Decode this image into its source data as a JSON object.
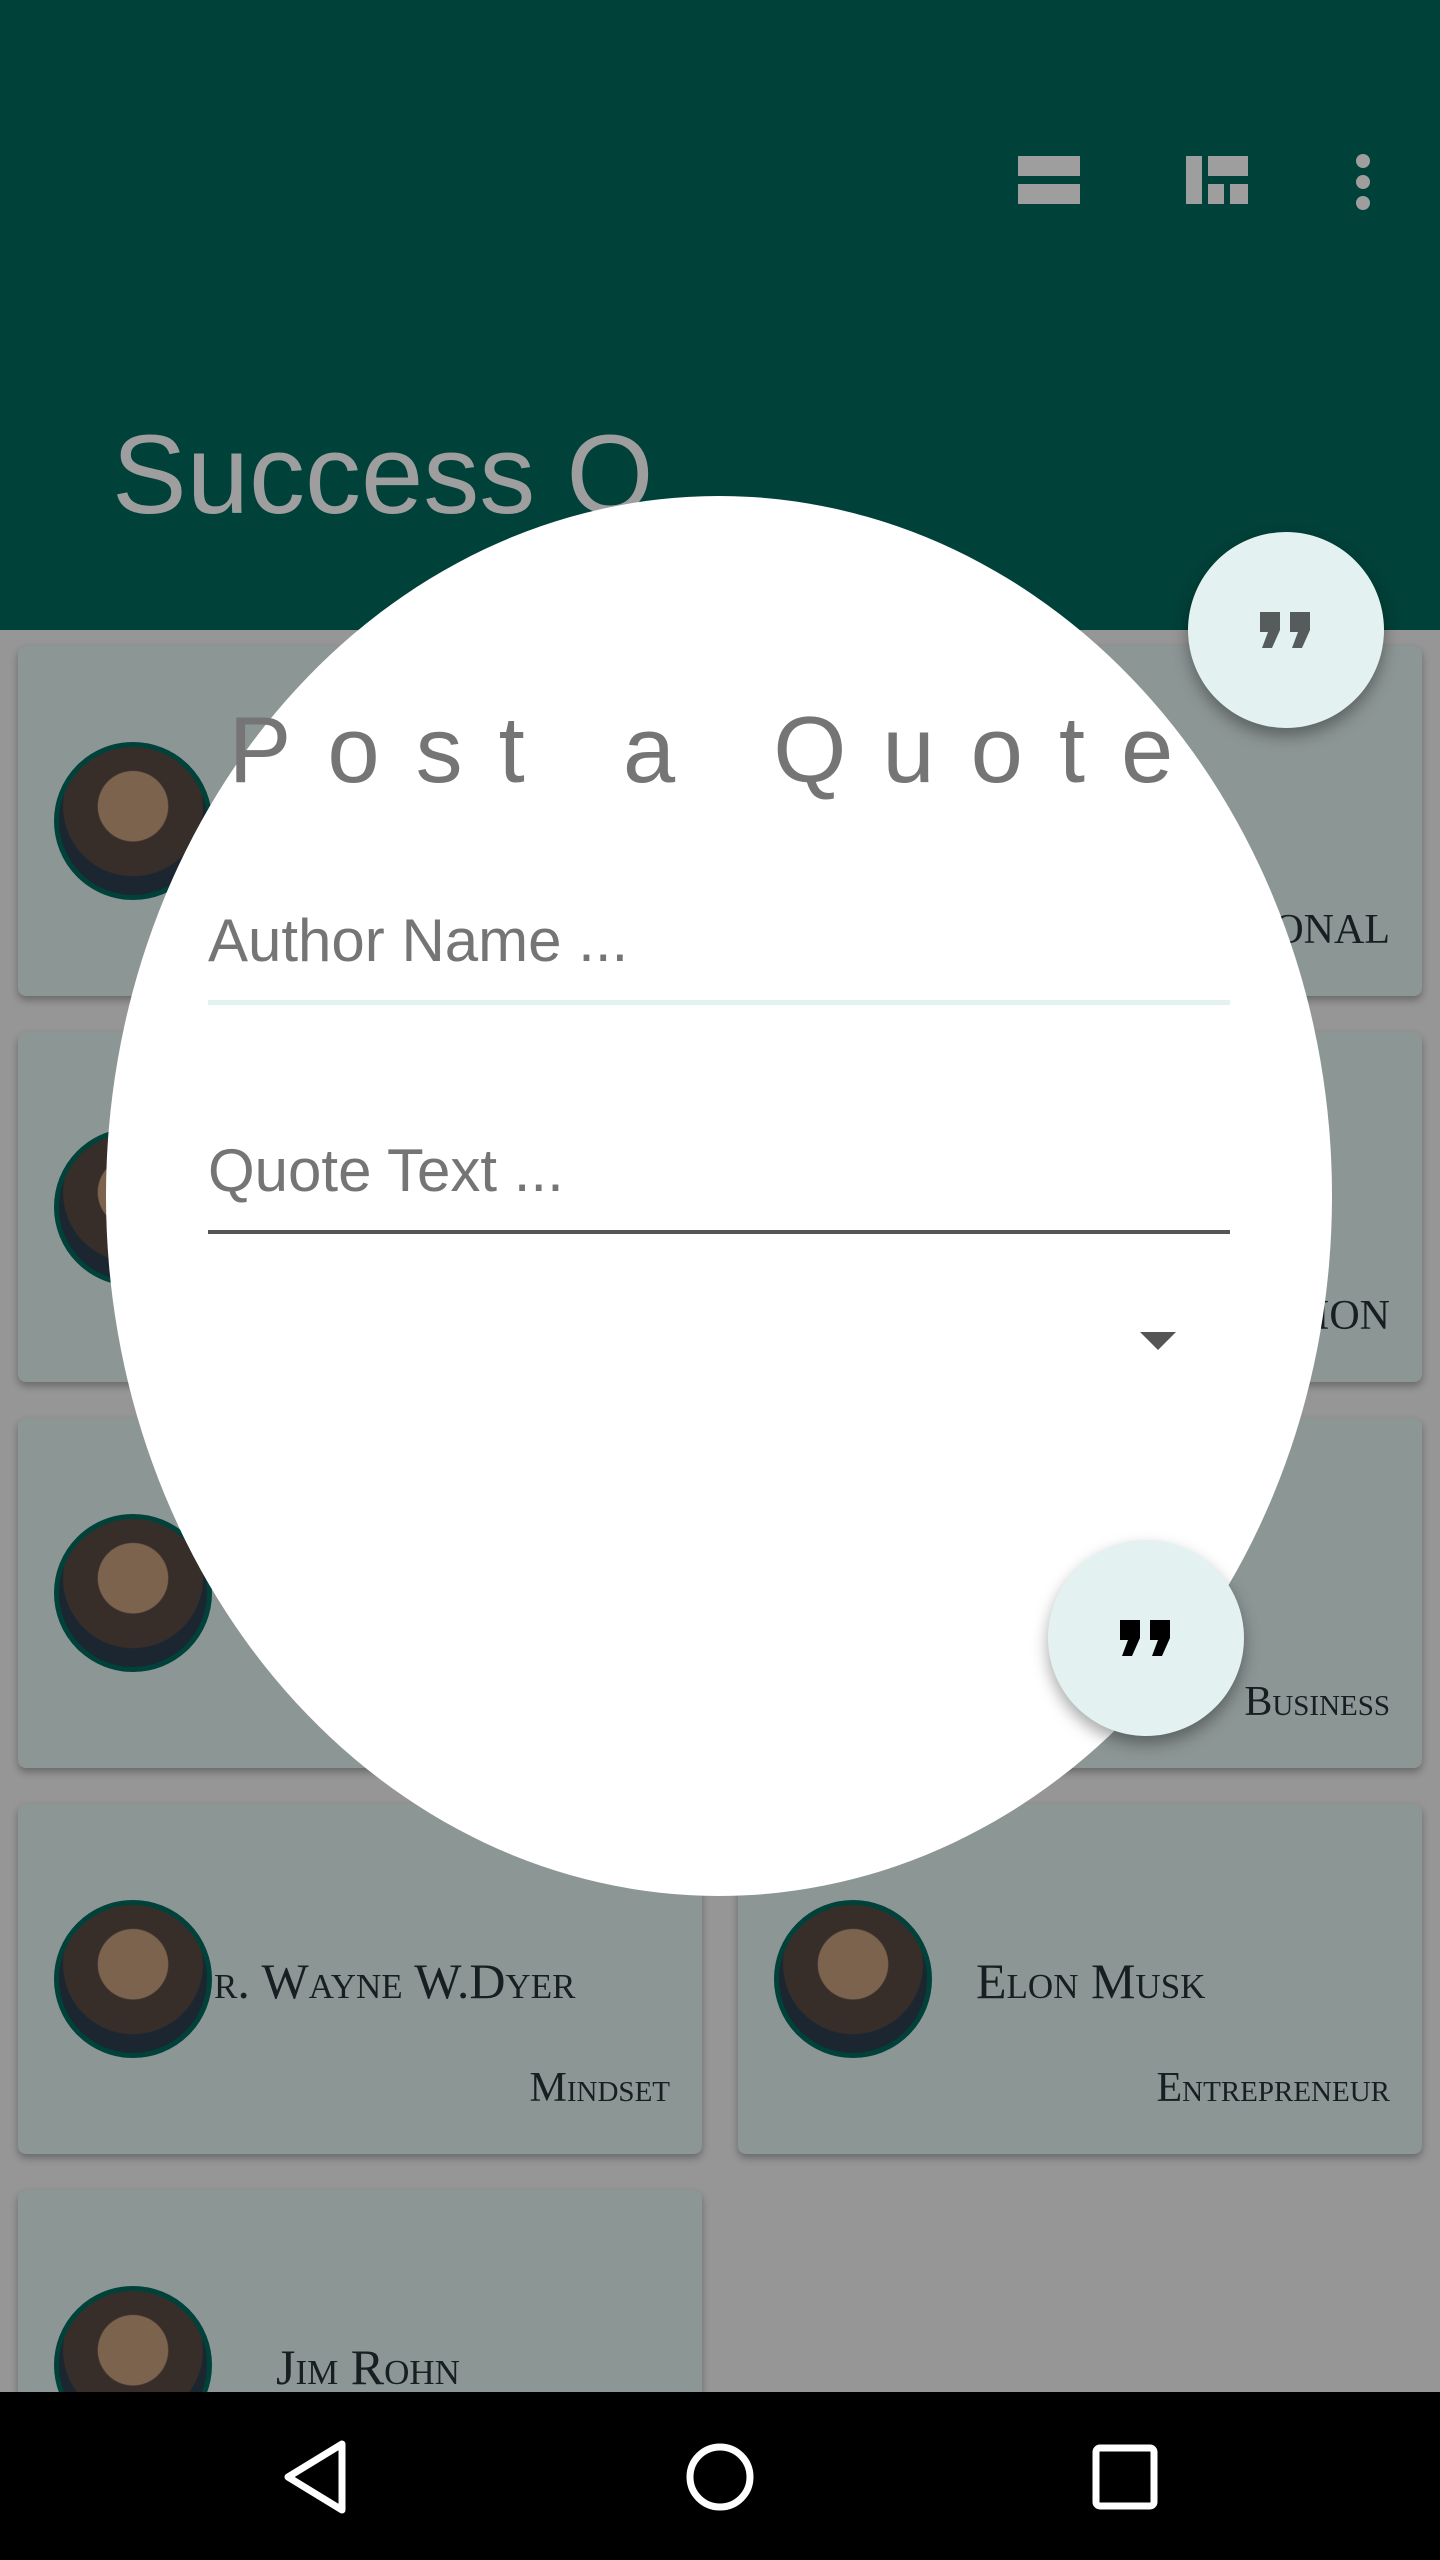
{
  "app": {
    "title": "Success Q",
    "icons": [
      "view-list-icon",
      "view-quilt-icon",
      "more-vert-icon"
    ]
  },
  "cards": [
    {
      "author": "",
      "category": "Motivational",
      "visible_category": "ONAL"
    },
    {
      "author": "",
      "category": "",
      "visible_category": "ION"
    },
    {
      "author": "",
      "category": "Business",
      "visible_category": "Business"
    },
    {
      "author": "Dr. Wayne W.Dyer",
      "visible_author": "r. Wayne W.Dyer",
      "category": "Mindset"
    },
    {
      "author": "Elon Musk",
      "category": "Entrepreneur"
    },
    {
      "author": "Jim Rohn",
      "category": ""
    }
  ],
  "dialog": {
    "title": "Post a Quote",
    "author_placeholder": "Author Name ...",
    "quote_placeholder": "Quote Text ...",
    "dropdown_value": ""
  },
  "colors": {
    "primary": "#00695c",
    "accent_light": "#e3f2f1",
    "text_dark": "#263238"
  },
  "nav": {
    "icons": [
      "back-icon",
      "home-icon",
      "recents-icon"
    ]
  }
}
